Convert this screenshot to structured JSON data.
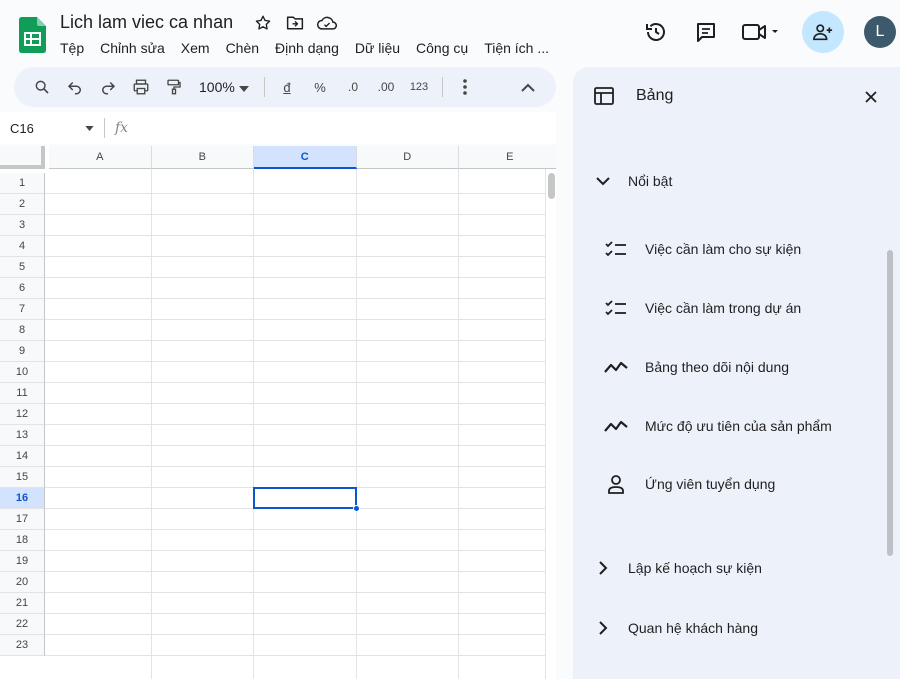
{
  "header": {
    "title": "Lich lam viec ca nhan",
    "menu": [
      "Tệp",
      "Chỉnh sửa",
      "Xem",
      "Chèn",
      "Định dạng",
      "Dữ liệu",
      "Công cụ",
      "Tiện ích ..."
    ],
    "avatar_letter": "L"
  },
  "toolbar": {
    "zoom": "100%",
    "currency": "đ",
    "percent": "%",
    "dec_decrease": ".0",
    "dec_increase": ".00",
    "format_more": "123"
  },
  "formula_bar": {
    "name_box": "C16",
    "fx_label": "fx"
  },
  "grid": {
    "columns": [
      "A",
      "B",
      "C",
      "D",
      "E"
    ],
    "rows": [
      "1",
      "2",
      "3",
      "4",
      "5",
      "6",
      "7",
      "8",
      "9",
      "10",
      "11",
      "12",
      "13",
      "14",
      "15",
      "16",
      "17",
      "18",
      "19",
      "20",
      "21",
      "22",
      "23"
    ],
    "selected_column": "C",
    "selected_row": "16"
  },
  "panel": {
    "title": "Bảng",
    "sections": [
      {
        "label": "Nổi bật",
        "expanded": true
      },
      {
        "label": "Lập kế hoạch sự kiện",
        "expanded": false
      },
      {
        "label": "Quan hệ khách hàng",
        "expanded": false
      }
    ],
    "items": [
      {
        "label": "Việc cần làm cho sự kiện",
        "icon": "checklist-icon"
      },
      {
        "label": "Việc cần làm trong dự án",
        "icon": "checklist-icon"
      },
      {
        "label": "Bảng theo dõi nội dung",
        "icon": "trend-icon"
      },
      {
        "label": "Mức độ ưu tiên của sản phẩm",
        "icon": "trend-icon"
      },
      {
        "label": "Ứng viên tuyển dụng",
        "icon": "person-icon"
      }
    ]
  },
  "colors": {
    "accent": "#0b57d0",
    "share_bg": "#c2e7ff",
    "panel_bg": "#edf2fa",
    "sheets_green": "#0f9d58"
  }
}
